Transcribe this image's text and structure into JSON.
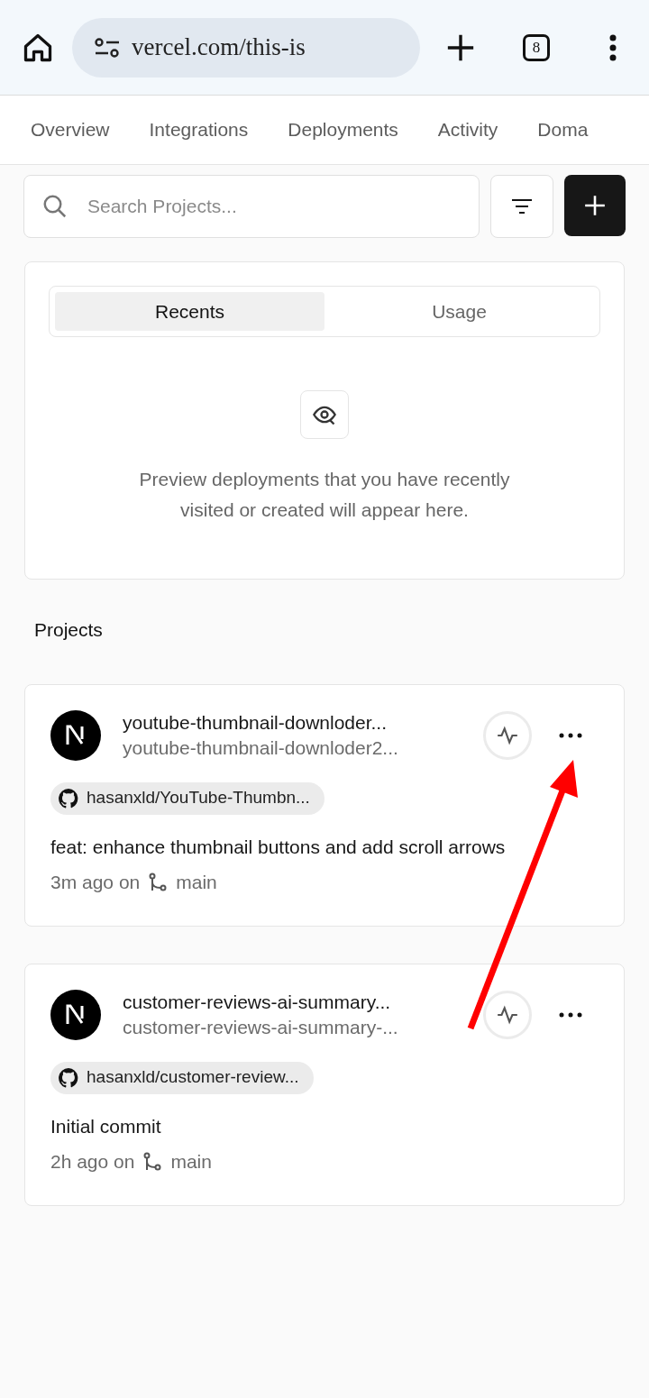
{
  "browser": {
    "url": "vercel.com/this-is",
    "tab_count": "8"
  },
  "nav_tabs": [
    {
      "label": "Overview",
      "selected": false
    },
    {
      "label": "Integrations",
      "selected": false
    },
    {
      "label": "Deployments",
      "selected": false
    },
    {
      "label": "Activity",
      "selected": false
    },
    {
      "label": "Doma",
      "selected": false
    }
  ],
  "search": {
    "placeholder": "Search Projects..."
  },
  "recents": {
    "tabs": [
      {
        "label": "Recents",
        "selected": true
      },
      {
        "label": "Usage",
        "selected": false
      }
    ],
    "empty_message": "Preview deployments that you have recently visited or created will appear here."
  },
  "projects_heading": "Projects",
  "projects": [
    {
      "name": "youtube-thumbnail-downloder...",
      "domain": "youtube-thumbnail-downloder2...",
      "repo": "hasanxld/YouTube-Thumbn...",
      "commit": "feat: enhance thumbnail buttons and add scroll arrows",
      "time": "3m ago on",
      "branch": "main"
    },
    {
      "name": "customer-reviews-ai-summary...",
      "domain": "customer-reviews-ai-summary-...",
      "repo": "hasanxld/customer-review...",
      "commit": "Initial commit",
      "time": "2h ago on",
      "branch": "main"
    }
  ]
}
